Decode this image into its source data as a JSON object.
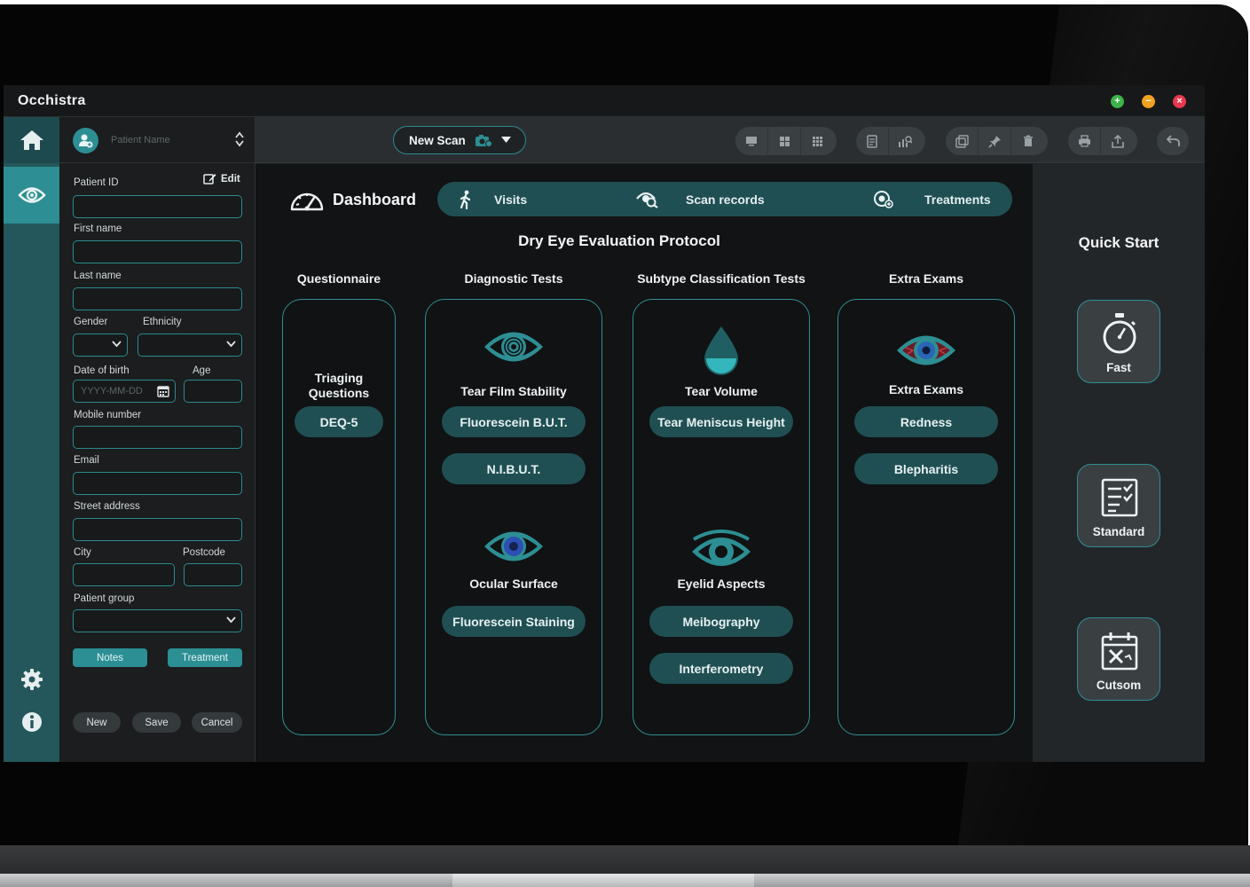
{
  "app": {
    "title": "Occhistra",
    "window_buttons": [
      "maximize",
      "minimize",
      "close"
    ]
  },
  "rail": {
    "items": [
      "home-icon",
      "eye-icon",
      "gear-icon",
      "info-icon"
    ]
  },
  "patient_panel": {
    "search_placeholder": "Patient Name",
    "edit_label": "Edit",
    "fields": {
      "patient_id": "Patient ID",
      "first_name": "First name",
      "last_name": "Last name",
      "gender": "Gender",
      "ethnicity": "Ethnicity",
      "dob": "Date of birth",
      "dob_placeholder": "YYYY-MM-DD",
      "age": "Age",
      "mobile": "Mobile number",
      "email": "Email",
      "street": "Street address",
      "city": "City",
      "postcode": "Postcode",
      "patient_group": "Patient group"
    },
    "buttons": {
      "notes": "Notes",
      "treatment": "Treatment",
      "new": "New",
      "save": "Save",
      "cancel": "Cancel"
    }
  },
  "toolbar": {
    "new_scan_label": "New Scan",
    "groups": [
      [
        "single-view-icon",
        "grid-2x2-icon",
        "grid-3x3-icon"
      ],
      [
        "report-icon",
        "analysis-icon"
      ],
      [
        "compare-icon",
        "pin-icon",
        "delete-icon"
      ],
      [
        "print-icon",
        "export-icon"
      ],
      [
        "undo-icon"
      ]
    ]
  },
  "dashboard": {
    "title": "Dashboard",
    "nav": {
      "visits": "Visits",
      "scan_records": "Scan records",
      "treatments": "Treatments"
    },
    "protocol_title": "Dry Eye Evaluation Protocol",
    "columns": {
      "questionnaire": {
        "heading": "Questionnaire",
        "section_title": "Triaging Questions",
        "buttons": [
          "DEQ-5"
        ]
      },
      "diagnostic": {
        "heading": "Diagnostic Tests",
        "section1_title": "Tear Film Stability",
        "section1_buttons": [
          "Fluorescein B.U.T.",
          "N.I.B.U.T."
        ],
        "section2_title": "Ocular Surface",
        "section2_buttons": [
          "Fluorescein Staining"
        ]
      },
      "subtype": {
        "heading": "Subtype Classification Tests",
        "section1_title": "Tear Volume",
        "section1_buttons": [
          "Tear Meniscus Height"
        ],
        "section2_title": "Eyelid Aspects",
        "section2_buttons": [
          "Meibography",
          "Interferometry"
        ]
      },
      "extra": {
        "heading": "Extra Exams",
        "section_title": "Extra Exams",
        "buttons": [
          "Redness",
          "Blepharitis"
        ]
      }
    }
  },
  "quick_start": {
    "title": "Quick Start",
    "cards": {
      "fast": "Fast",
      "standard": "Standard",
      "custom": "Cutsom"
    }
  },
  "colors": {
    "accent_teal": "#2d8e93",
    "dark_teal": "#1f4f53",
    "rail": "#24575b",
    "background": "#111314"
  }
}
